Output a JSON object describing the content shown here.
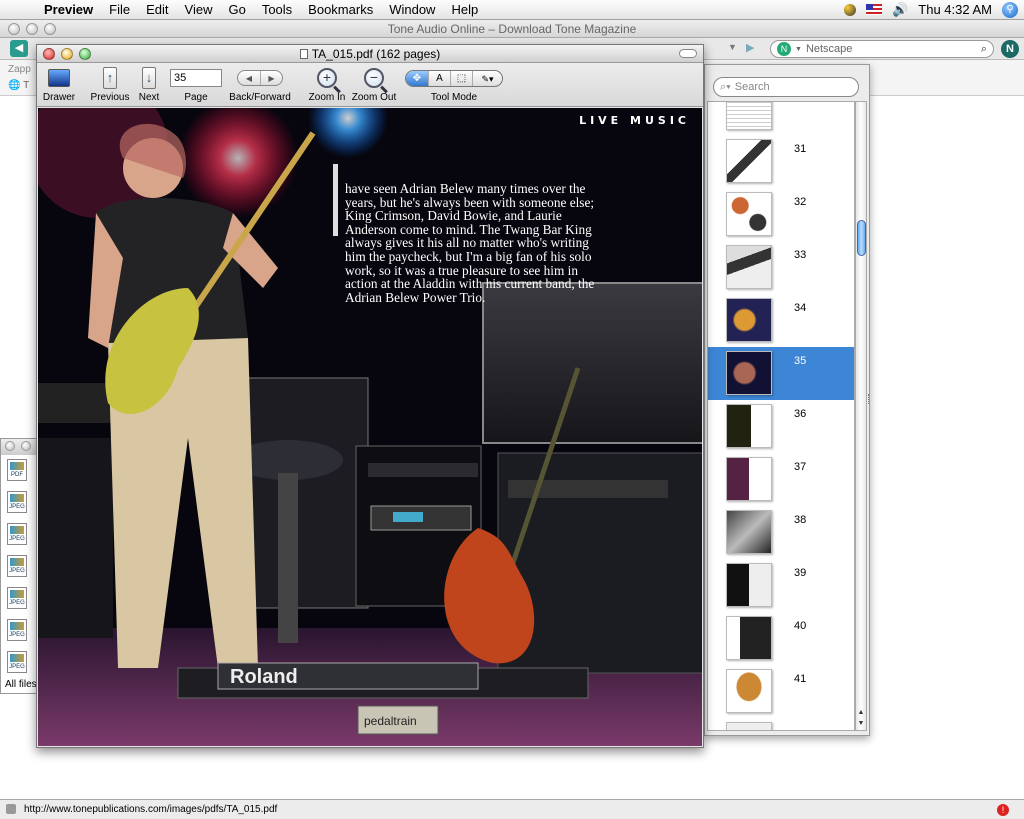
{
  "menubar": {
    "app": "Preview",
    "items": [
      "File",
      "Edit",
      "View",
      "Go",
      "Tools",
      "Bookmarks",
      "Window",
      "Help"
    ],
    "clock": "Thu 4:32 AM"
  },
  "browser": {
    "title": "Tone Audio Online – Download Tone Magazine",
    "search_placeholder": "Netscape",
    "tab_label": "Zapp",
    "tab_item": "T",
    "status_url": "http://www.tonepublications.com/images/pdfs/TA_015.pdf"
  },
  "filelist": {
    "icons": [
      "PDF",
      "JPEG",
      "JPEG",
      "JPEG",
      "JPEG",
      "JPEG",
      "JPEG"
    ],
    "footer": "All files"
  },
  "preview": {
    "title": "TA_015.pdf (162 pages)",
    "toolbar": {
      "drawer": "Drawer",
      "previous": "Previous",
      "next": "Next",
      "page_value": "35",
      "page_label": "Page",
      "backforward": "Back/Forward",
      "zoom_in": "Zoom In",
      "zoom_out": "Zoom Out",
      "tool_mode": "Tool Mode",
      "tool_text": "A"
    },
    "page": {
      "section_label": "LIVE MUSIC",
      "quote": "have seen Adrian Belew many times over the years, but he's always been with someone else; King Crimson, David Bowie, and Laurie Anderson come to mind.  The Twang Bar King always gives it his all no matter who's writing him the paycheck, but I'm a big fan of his solo work, so it was a true pleasure to see him in action at the Aladdin with his current band, the Adrian Belew Power Trio.",
      "amp_brand": "Roland",
      "pedalboard_brand": "pedaltrain"
    }
  },
  "sidebar": {
    "search_placeholder": "Search",
    "thumbnails": [
      {
        "num": ""
      },
      {
        "num": "31"
      },
      {
        "num": "32"
      },
      {
        "num": "33"
      },
      {
        "num": "34"
      },
      {
        "num": "35"
      },
      {
        "num": "36"
      },
      {
        "num": "37"
      },
      {
        "num": "38"
      },
      {
        "num": "39"
      },
      {
        "num": "40"
      },
      {
        "num": "41"
      },
      {
        "num": ""
      }
    ],
    "selected_page": "35"
  }
}
